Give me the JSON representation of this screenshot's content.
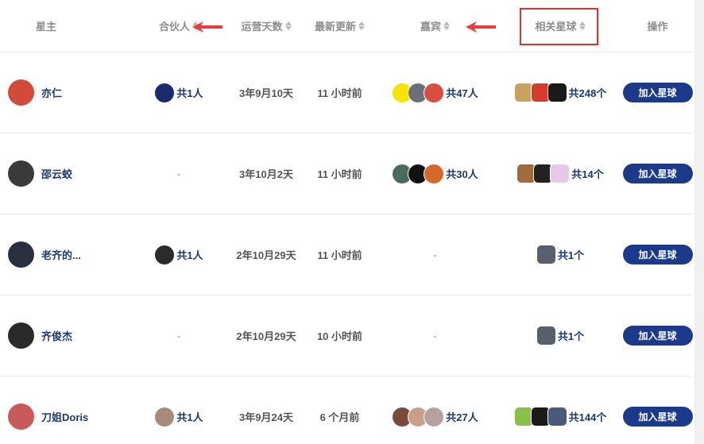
{
  "header": {
    "name": "星主",
    "partner": "合伙人",
    "days": "运营天数",
    "update": "最新更新",
    "guest": "嘉宾",
    "related": "相关星球",
    "op": "操作"
  },
  "rows": [
    {
      "name": "亦仁",
      "avatar_color": "#d14a3a",
      "partner_count": "共1人",
      "partner_colors": [
        "#1a2b6e"
      ],
      "days": "3年9月10天",
      "update": "11 小时前",
      "guest_count": "共47人",
      "guest_colors": [
        "#f5e400",
        "#6b6f78",
        "#d74e3c"
      ],
      "related_count": "共248个",
      "related_colors": [
        "#c9a35b",
        "#d83b2b",
        "#1a1a1a"
      ],
      "button": "加入星球"
    },
    {
      "name": "邵云蛟",
      "avatar_color": "#3a3a3a",
      "partner_count": "-",
      "partner_colors": [],
      "days": "3年10月2天",
      "update": "11 小时前",
      "guest_count": "共30人",
      "guest_colors": [
        "#4b6a5b",
        "#111111",
        "#d36a2a"
      ],
      "related_count": "共14个",
      "related_colors": [
        "#a06a3a",
        "#222222",
        "#e8c8e8"
      ],
      "button": "加入星球"
    },
    {
      "name": "老齐的...",
      "avatar_color": "#2b3040",
      "partner_count": "共1人",
      "partner_colors": [
        "#2b2b2b"
      ],
      "days": "2年10月29天",
      "update": "11 小时前",
      "guest_count": "-",
      "guest_colors": [],
      "related_count": "共1个",
      "related_colors": [
        "#5a5f6e"
      ],
      "button": "加入星球"
    },
    {
      "name": "齐俊杰",
      "avatar_color": "#2a2a2a",
      "partner_count": "-",
      "partner_colors": [],
      "days": "2年10月29天",
      "update": "10 小时前",
      "guest_count": "-",
      "guest_colors": [],
      "related_count": "共1个",
      "related_colors": [
        "#5a5f6e"
      ],
      "button": "加入星球"
    },
    {
      "name": "刀姐Doris",
      "avatar_color": "#c85a5a",
      "partner_count": "共1人",
      "partner_colors": [
        "#a88a7a"
      ],
      "days": "3年9月24天",
      "update": "6 个月前",
      "guest_count": "共27人",
      "guest_colors": [
        "#7a4a3a",
        "#c8a08a",
        "#b8a0a0"
      ],
      "related_count": "共144个",
      "related_colors": [
        "#8ac04a",
        "#1a1a1a",
        "#4a5a7a"
      ],
      "button": "加入星球"
    }
  ]
}
